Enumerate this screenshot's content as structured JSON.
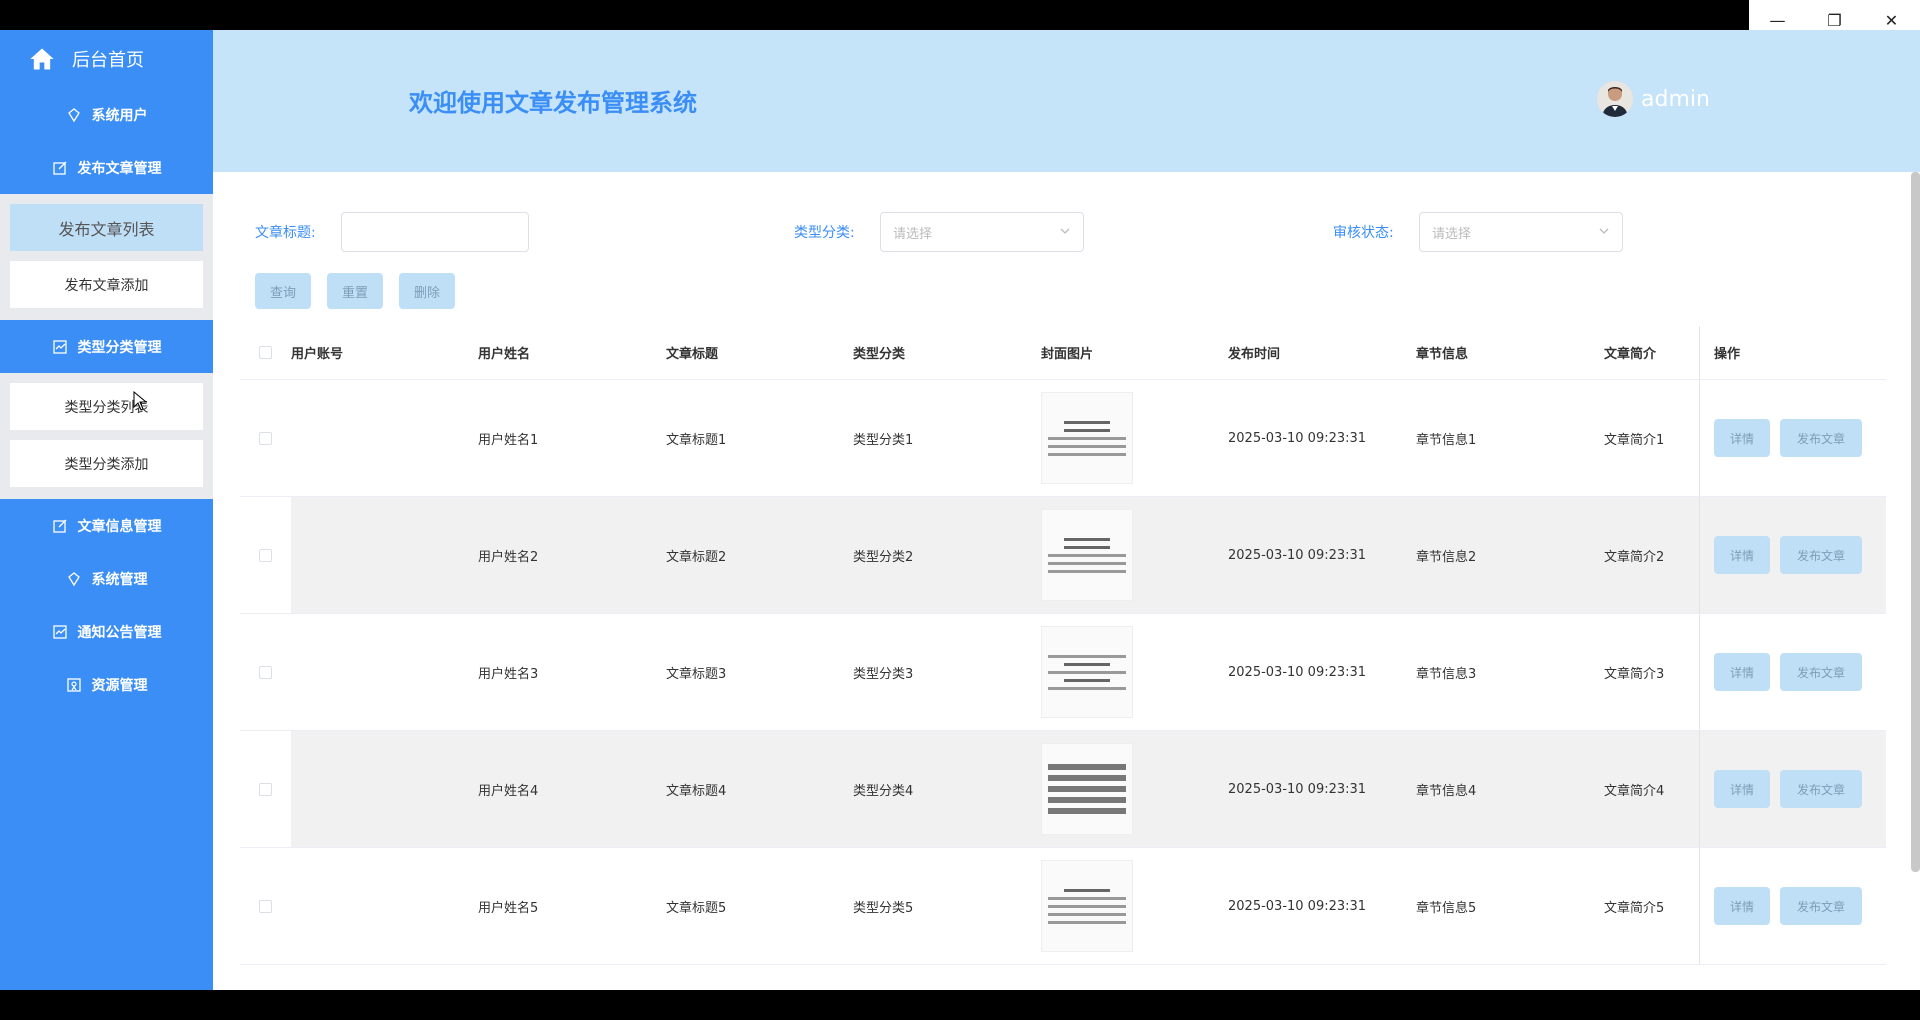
{
  "window": {
    "controls": [
      "—",
      "❐",
      "✕"
    ]
  },
  "sidebar": {
    "home": "后台首页",
    "items": [
      {
        "label": "系统用户",
        "icon": "diamond-icon"
      },
      {
        "label": "发布文章管理",
        "icon": "edit-icon"
      },
      {
        "label": "类型分类管理",
        "icon": "chart-icon"
      },
      {
        "label": "文章信息管理",
        "icon": "edit-icon"
      },
      {
        "label": "系统管理",
        "icon": "diamond-icon"
      },
      {
        "label": "通知公告管理",
        "icon": "chart-icon"
      },
      {
        "label": "资源管理",
        "icon": "badge-icon"
      }
    ],
    "sub_publish": [
      "发布文章列表",
      "发布文章添加"
    ],
    "sub_category": [
      "类型分类列表",
      "类型分类添加"
    ]
  },
  "header": {
    "title": "欢迎使用文章发布管理系统",
    "user": "admin"
  },
  "filters": {
    "title_label": "文章标题:",
    "category_label": "类型分类:",
    "category_placeholder": "请选择",
    "review_label": "审核状态:",
    "review_placeholder": "请选择"
  },
  "buttons": {
    "query": "查询",
    "reset": "重置",
    "delete": "删除"
  },
  "table": {
    "headers": [
      "用户账号",
      "用户姓名",
      "文章标题",
      "类型分类",
      "封面图片",
      "发布时间",
      "章节信息",
      "文章简介",
      "操作"
    ],
    "rows": [
      {
        "account": "",
        "name": "用户姓名1",
        "title": "文章标题1",
        "category": "类型分类1",
        "time": "2025-03-10 09:23:31",
        "chapter": "章节信息1",
        "intro": "文章简介1"
      },
      {
        "account": "",
        "name": "用户姓名2",
        "title": "文章标题2",
        "category": "类型分类2",
        "time": "2025-03-10 09:23:31",
        "chapter": "章节信息2",
        "intro": "文章简介2"
      },
      {
        "account": "",
        "name": "用户姓名3",
        "title": "文章标题3",
        "category": "类型分类3",
        "time": "2025-03-10 09:23:31",
        "chapter": "章节信息3",
        "intro": "文章简介3"
      },
      {
        "account": "",
        "name": "用户姓名4",
        "title": "文章标题4",
        "category": "类型分类4",
        "time": "2025-03-10 09:23:31",
        "chapter": "章节信息4",
        "intro": "文章简介4"
      },
      {
        "account": "",
        "name": "用户姓名5",
        "title": "文章标题5",
        "category": "类型分类5",
        "time": "2025-03-10 09:23:31",
        "chapter": "章节信息5",
        "intro": "文章简介5"
      }
    ],
    "op_detail": "详情",
    "op_publish": "发布文章"
  },
  "colors": {
    "sidebar": "#3a8ef6",
    "header": "#c5e3f9",
    "button": "#bfdff7",
    "accent": "#3a8ef6"
  }
}
